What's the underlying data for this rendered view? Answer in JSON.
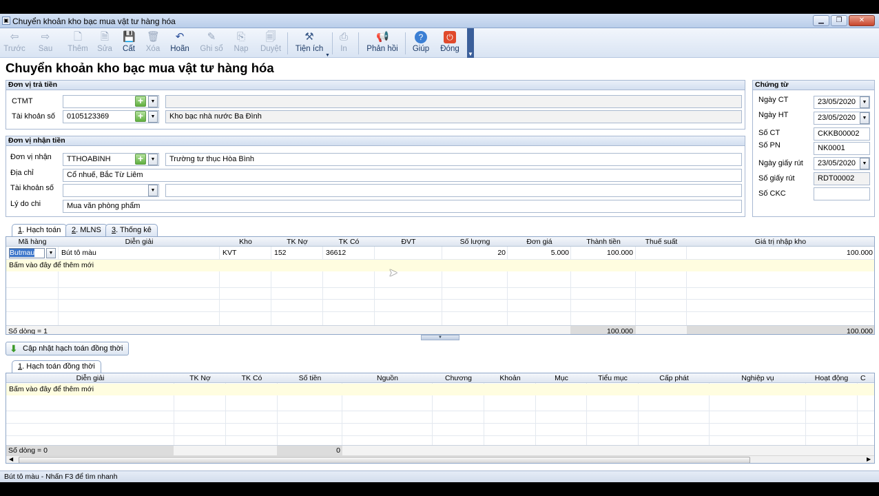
{
  "window": {
    "title": "Chuyển khoản kho bạc mua vật tư hàng hóa"
  },
  "toolbar": {
    "back": "Trước",
    "next": "Sau",
    "add": "Thêm",
    "edit": "Sửa",
    "save": "Cất",
    "delete": "Xóa",
    "undo": "Hoãn",
    "post": "Ghi sổ",
    "load": "Nạp",
    "approve": "Duyệt",
    "utilities": "Tiện ích",
    "print": "In",
    "feedback": "Phản hồi",
    "help": "Giúp",
    "close": "Đóng"
  },
  "page_title": "Chuyển khoản kho bạc mua vật tư hàng hóa",
  "payer": {
    "header": "Đơn vị trả tiền",
    "ctmt_label": "CTMT",
    "ctmt_value": "",
    "ctmt_desc": "",
    "account_label": "Tài khoản số",
    "account_value": "0105123369",
    "account_desc": "Kho bạc nhà nước Ba Đình"
  },
  "receiver": {
    "header": "Đơn vị nhận tiền",
    "unit_label": "Đơn vị nhận",
    "unit_value": "TTHOABINH",
    "unit_desc": "Trường tư thục Hòa Bình",
    "address_label": "Địa chỉ",
    "address_value": "Cổ nhuế, Bắc Từ Liêm",
    "account_label": "Tài khoản số",
    "account_value": "",
    "account_desc": "",
    "reason_label": "Lý do chi",
    "reason_value": "Mua văn phòng phẩm"
  },
  "voucher": {
    "header": "Chứng từ",
    "date_ct_label": "Ngày CT",
    "date_ct": "23/05/2020",
    "date_ht_label": "Ngày HT",
    "date_ht": "23/05/2020",
    "so_ct_label": "Số CT",
    "so_ct": "CKKB00002",
    "so_pn_label": "Số PN",
    "so_pn": "NK0001",
    "withdraw_date_label": "Ngày giấy rút",
    "withdraw_date": "23/05/2020",
    "withdraw_no_label": "Số giấy rút",
    "withdraw_no": "RDT00002",
    "ckc_label": "Số CKC",
    "ckc": ""
  },
  "tabs": [
    {
      "key": "1",
      "label": "Hạch toán"
    },
    {
      "key": "2",
      "label": "MLNS"
    },
    {
      "key": "3",
      "label": "Thống kê"
    }
  ],
  "grid1": {
    "columns": [
      "Mã hàng",
      "Diễn giải",
      "Kho",
      "TK Nợ",
      "TK Có",
      "ĐVT",
      "Số lượng",
      "Đơn giá",
      "Thành tiền",
      "Thuế suất",
      "Giá trị nhập kho"
    ],
    "row": {
      "ma_hang": "Butmau",
      "dien_giai": "Bút tô màu",
      "kho": "KVT",
      "tk_no": "152",
      "tk_co": "36612",
      "dvt": "",
      "so_luong": "20",
      "don_gia": "5.000",
      "thanh_tien": "100.000",
      "thue_suat": "",
      "gia_tri": "100.000"
    },
    "new_row": "Bấm vào đây để thêm mới",
    "footer_count": "Số dòng = 1",
    "footer_thanh_tien": "100.000",
    "footer_gia_tri": "100.000"
  },
  "update_button": "Cập nhật hạch toán đồng thời",
  "tab2": {
    "key": "1",
    "label": "Hạch toán đồng thời"
  },
  "grid2": {
    "columns": [
      "Diễn giải",
      "TK Nợ",
      "TK Có",
      "Số tiền",
      "Nguồn",
      "Chương",
      "Khoản",
      "Mục",
      "Tiểu mục",
      "Cấp phát",
      "Nghiệp vụ",
      "Hoạt động",
      "C"
    ],
    "new_row": "Bấm vào đây để thêm mới",
    "footer_count": "Số dòng = 0",
    "footer_amount": "0"
  },
  "status": "Bút tô màu - Nhấn F3 để tìm nhanh",
  "colors": {
    "accent": "#3b5f9a",
    "new_row": "#fffde0",
    "header_bg": "#d3dff0"
  }
}
